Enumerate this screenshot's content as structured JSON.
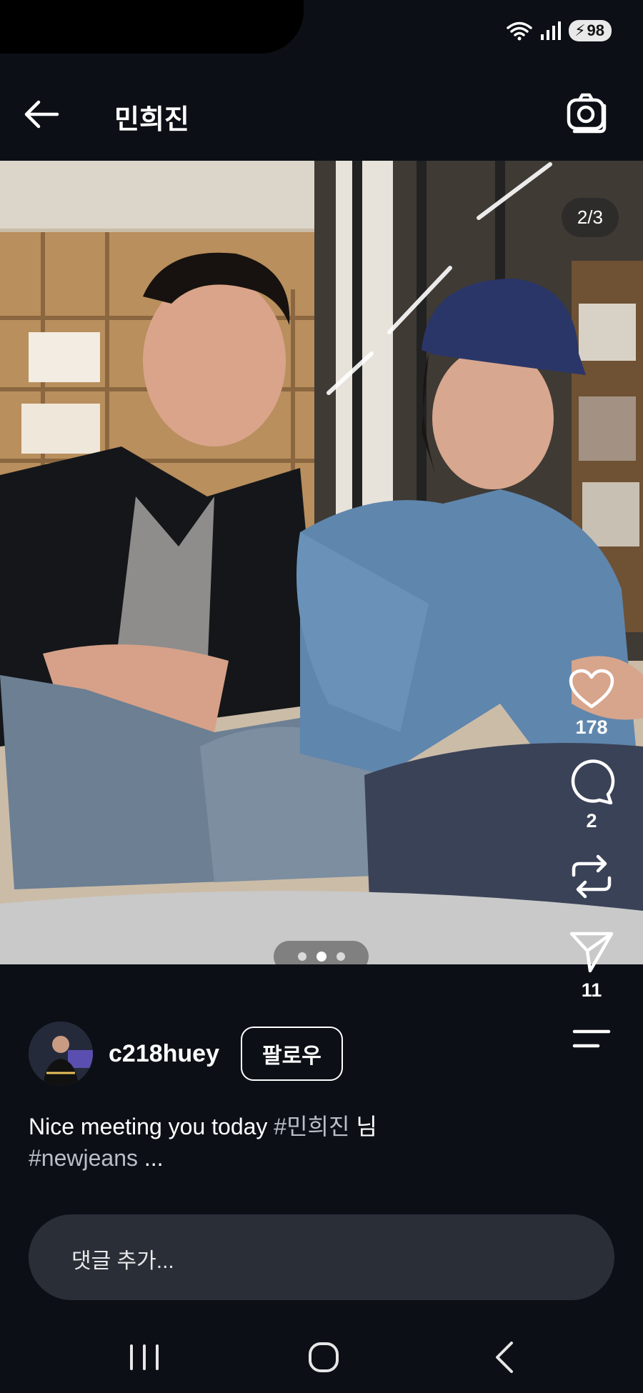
{
  "status": {
    "battery": "98"
  },
  "header": {
    "title": "민희진"
  },
  "photo": {
    "counter": "2/3",
    "page_dots": 3,
    "active_dot": 2
  },
  "actions": {
    "likes": "178",
    "comments": "2",
    "shares": "11"
  },
  "author": {
    "username": "c218huey",
    "follow_label": "팔로우"
  },
  "caption": {
    "text1": "Nice meeting you today ",
    "tag1": "#민희진",
    "text2": " 님",
    "tag2": "#newjeans",
    "more": " ..."
  },
  "comment": {
    "placeholder": "댓글 추가..."
  },
  "colors": {
    "background": "#0c1016",
    "input_bg": "#2a2e37",
    "tag_color": "#b9bec8"
  },
  "icons": [
    "wifi-icon",
    "signal-icon",
    "battery-icon",
    "back-arrow-icon",
    "camera-icon",
    "heart-icon",
    "comment-icon",
    "repost-icon",
    "send-icon",
    "menu-icon",
    "nav-recents-icon",
    "nav-home-icon",
    "nav-back-icon"
  ]
}
